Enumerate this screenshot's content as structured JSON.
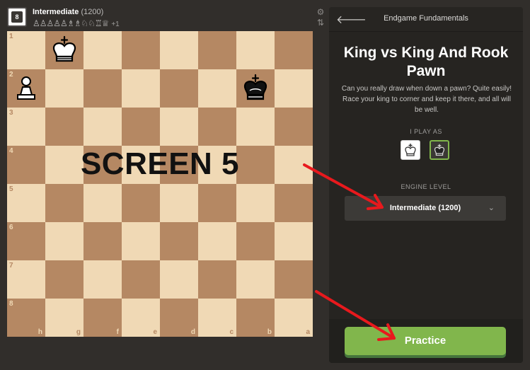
{
  "player": {
    "avatar_number": "8",
    "name": "Intermediate",
    "rating": "(1200)",
    "captured": "♙♙♙♙♙♗♗♘♘♖♕",
    "advantage": "+1"
  },
  "side_icons": [
    "gear-icon",
    "flip-board-icon"
  ],
  "board": {
    "rank_labels": [
      "1",
      "2",
      "3",
      "4",
      "5",
      "6",
      "7",
      "8"
    ],
    "file_labels": [
      "h",
      "g",
      "f",
      "e",
      "d",
      "c",
      "b",
      "a"
    ],
    "pieces": [
      {
        "type": "king",
        "color": "white",
        "rank": "1",
        "file": "g"
      },
      {
        "type": "pawn",
        "color": "white",
        "rank": "2",
        "file": "h"
      },
      {
        "type": "king",
        "color": "black",
        "rank": "2",
        "file": "b"
      }
    ],
    "light_color": "#f0d9b5",
    "dark_color": "#b58863"
  },
  "overlay_text": "SCREEN 5",
  "panel": {
    "title": "Endgame Fundamentals",
    "lesson_title": "King vs King And Rook Pawn",
    "description": "Can you really draw when down a pawn? Quite easily! Race your king to corner and keep it there, and all will be well.",
    "i_play_as_label": "I PLAY AS",
    "selected_color": "black",
    "engine_level_label": "ENGINE LEVEL",
    "engine_level_name": "Intermediate",
    "engine_level_rating": "(1200)",
    "practice_label": "Practice",
    "accent_color": "#81b64c"
  },
  "annotations": {
    "arrow_color": "#e8191d"
  }
}
